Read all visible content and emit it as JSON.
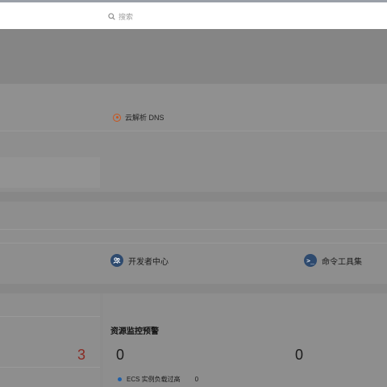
{
  "search": {
    "placeholder": "搜索"
  },
  "services": {
    "dns_label": "云解析 DNS",
    "developer_center_label": "开发者中心",
    "cli_tools_label": "命令工具集"
  },
  "monitor": {
    "title": "资源监控预警",
    "left_count": "3",
    "count_a": "0",
    "count_b": "0",
    "alerts": [
      {
        "label": "ECS 实例负载过高",
        "count": "0"
      }
    ]
  },
  "colors": {
    "dns_icon": "#c9541c",
    "tool_icon": "#2e4a6e",
    "alert_dot": "#1f5fa8",
    "warning_number": "#8a2b24"
  }
}
